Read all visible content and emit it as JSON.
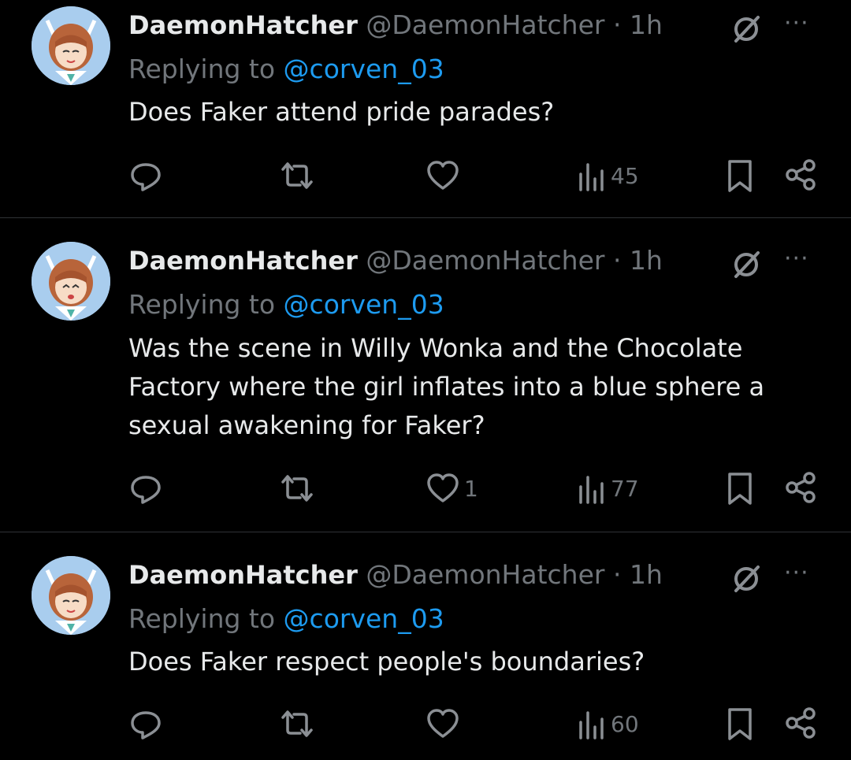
{
  "tweets": [
    {
      "name": "DaemonHatcher",
      "handle": "@DaemonHatcher",
      "dot": "·",
      "time": "1h",
      "replying_label": "Replying to",
      "replying_to": "@corven_03",
      "text": "Does Faker attend pride parades?",
      "likes": "",
      "views": "45",
      "more": "···"
    },
    {
      "name": "DaemonHatcher",
      "handle": "@DaemonHatcher",
      "dot": "·",
      "time": "1h",
      "replying_label": "Replying to",
      "replying_to": "@corven_03",
      "text": "Was the scene in Willy Wonka and the Chocolate Factory where the girl inflates into a blue sphere a sexual awakening for Faker?",
      "likes": "1",
      "views": "77",
      "more": "···"
    },
    {
      "name": "DaemonHatcher",
      "handle": "@DaemonHatcher",
      "dot": "·",
      "time": "1h",
      "replying_label": "Replying to",
      "replying_to": "@corven_03",
      "text": "Does Faker respect people's boundaries?",
      "likes": "",
      "views": "60",
      "more": "···"
    }
  ],
  "colors": {
    "background": "#000000",
    "text": "#e7e9ea",
    "muted": "#71767b",
    "link": "#1d9bf0",
    "divider": "#2f3336"
  }
}
